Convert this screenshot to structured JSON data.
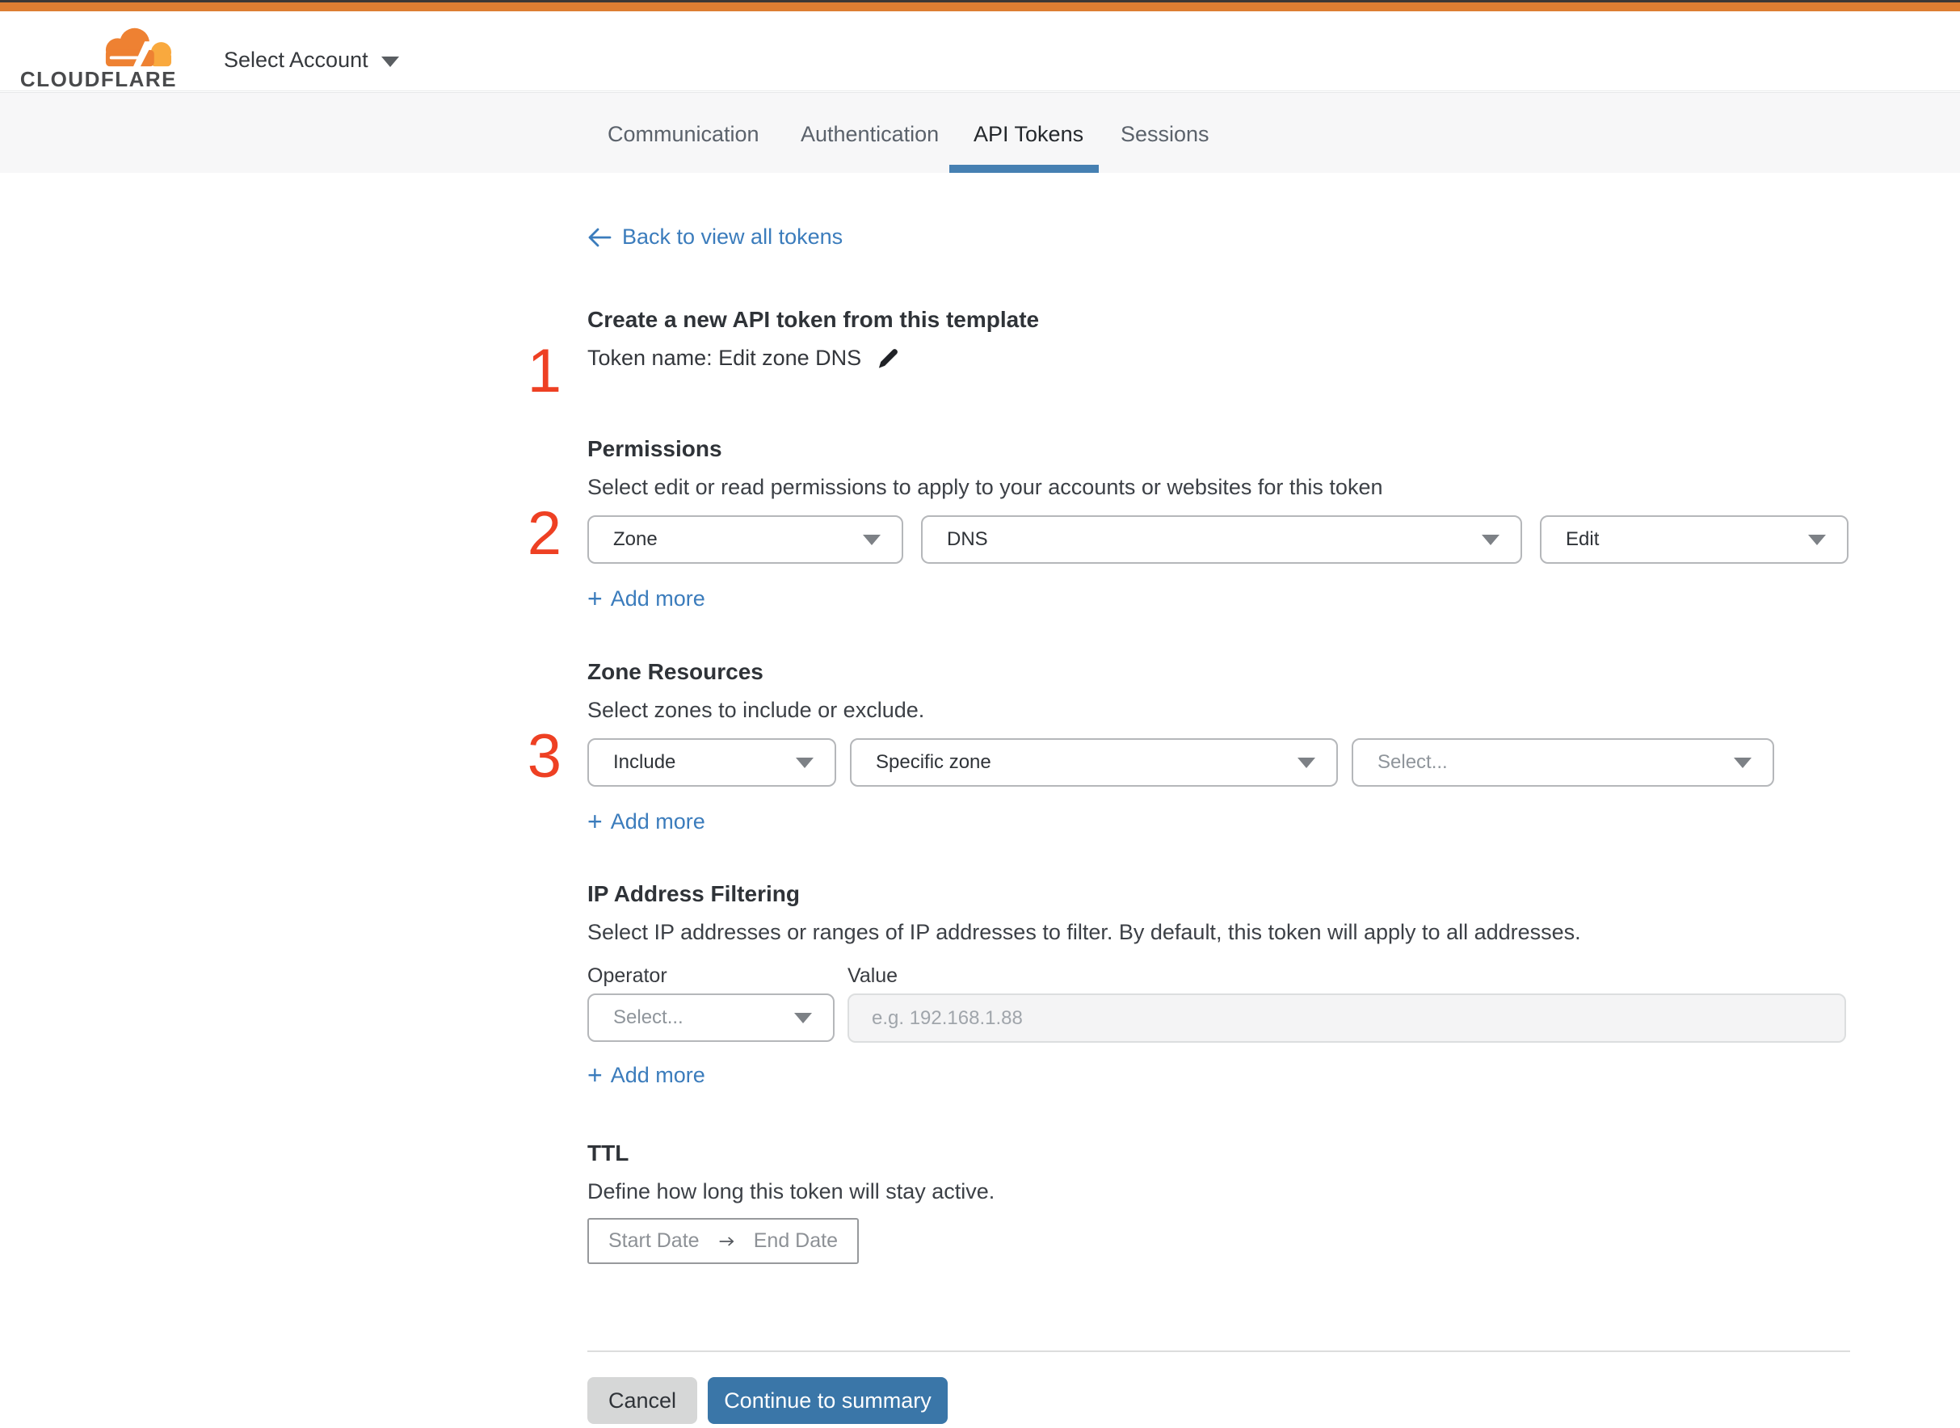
{
  "colors": {
    "topbar": "#dd7e32",
    "topbar_dark": "#3a3836",
    "brand_orange": "#ee8132",
    "brand_orange_light": "#f9a93e",
    "link_blue": "#3b7cbc",
    "tab_underline": "#4680b2",
    "button_blue": "#3a76a8",
    "step_red": "#ee4023"
  },
  "header": {
    "brand": "CLOUDFLARE",
    "account_selector": "Select Account"
  },
  "tabs": [
    {
      "label": "Communication",
      "active": false
    },
    {
      "label": "Authentication",
      "active": false
    },
    {
      "label": "API Tokens",
      "active": true
    },
    {
      "label": "Sessions",
      "active": false
    }
  ],
  "back_link": {
    "label": "Back to view all tokens"
  },
  "template_section": {
    "step_number": "1",
    "heading": "Create a new API token from this template",
    "token_name": "Token name: Edit zone DNS"
  },
  "permissions": {
    "step_number": "2",
    "heading": "Permissions",
    "description": "Select edit or read permissions to apply to your accounts or websites for this token",
    "scope": "Zone",
    "resource": "DNS",
    "access": "Edit",
    "plus": "+",
    "add_more": "Add more"
  },
  "zone_resources": {
    "step_number": "3",
    "heading": "Zone Resources",
    "description": "Select zones to include or exclude.",
    "mode": "Include",
    "scope": "Specific zone",
    "zone_placeholder": "Select...",
    "plus": "+",
    "add_more": "Add more"
  },
  "ip_filtering": {
    "heading": "IP Address Filtering",
    "description": "Select IP addresses or ranges of IP addresses to filter. By default, this token will apply to all addresses.",
    "operator_label": "Operator",
    "value_label": "Value",
    "operator_placeholder": "Select...",
    "value_placeholder": "e.g. 192.168.1.88",
    "plus": "+",
    "add_more": "Add more"
  },
  "ttl": {
    "heading": "TTL",
    "description": "Define how long this token will stay active.",
    "start_date": "Start Date",
    "end_date": "End Date"
  },
  "footer": {
    "cancel": "Cancel",
    "continue": "Continue to summary"
  }
}
